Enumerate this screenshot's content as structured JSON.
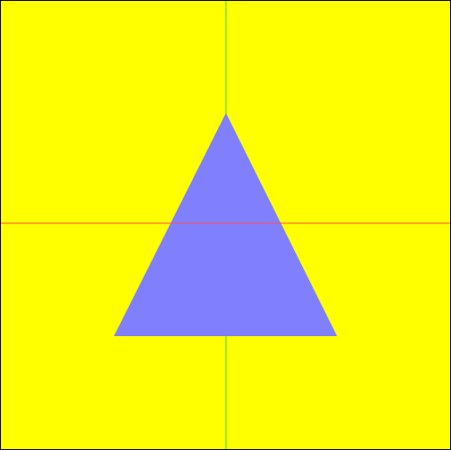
{
  "canvas": {
    "background_color": "#ffff00",
    "border_color": "#000000"
  },
  "axes": {
    "horizontal_axis_color": "#ff4d4d",
    "vertical_axis_color": "#40d040"
  },
  "shape": {
    "kind": "triangle",
    "fill_color": "#8080ff"
  }
}
